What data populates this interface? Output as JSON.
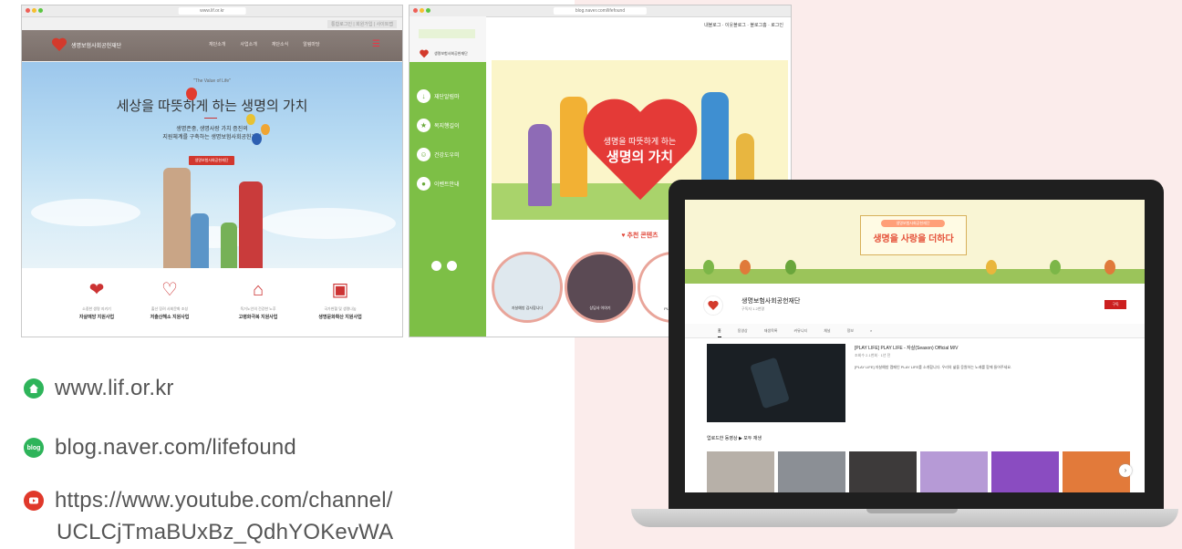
{
  "browser1": {
    "url": "www.lif.or.kr",
    "top_links": "통합로그인 | 회원가입 | 사이트맵",
    "logo_text": "생명보험사회공헌재단",
    "menu": [
      "재단소개",
      "사업소개",
      "재단소식",
      "알림마당"
    ],
    "hero_subtitle": "\"The Value of Life\"",
    "hero_title": "세상을 따뜻하게 하는 생명의 가치",
    "hero_desc1": "생명존중, 생명사랑 가치 증진의",
    "hero_desc2": "지원체계를 구축하는 생명보험사회공헌재단",
    "hero_button": "생명보험사회공헌재단",
    "services": [
      {
        "icon": "hands-heart-icon",
        "small": "소중한 생명 지키기",
        "label": "자살예방 지원사업"
      },
      {
        "icon": "pregnant-icon",
        "small": "출산 장려 사회문화 조성",
        "label": "저출산해소 지원사업"
      },
      {
        "icon": "house-heart-icon",
        "small": "독거노인의 건강한 노후",
        "label": "고령화극복 지원사업"
      },
      {
        "icon": "blood-bag-icon",
        "small": "국가헌혈 및 생명나눔",
        "label": "생명문화확산 지원사업"
      }
    ]
  },
  "browser2": {
    "url": "blog.naver.com/lifefound",
    "top_links": "내블로그 · 이웃블로그 · 블로그홈 · 로그인",
    "side_logo": "생명보험사회공헌재단",
    "side_menu": [
      "재단알림마",
      "복지행길이",
      "건강도우미",
      "이벤트안내"
    ],
    "hero_line1": "생명을 따뜻하게 하는",
    "hero_line2": "생명의 가치",
    "recommend_title": "♥ 추천 콘텐츠",
    "recommend": [
      "자살예방 감사합니다",
      "상담사 이야기",
      "PLAY LIFE"
    ]
  },
  "youtube": {
    "banner_tag": "생명보험사회공헌재단",
    "banner_title": "생명을 사랑을 더하다",
    "channel_name": "생명보험사회공헌재단",
    "subscribers": "구독자 1.2천명",
    "subscribe_label": "구독",
    "tabs": [
      "홈",
      "동영상",
      "재생목록",
      "커뮤니티",
      "채널",
      "정보"
    ],
    "featured_title": "[PLAY LIFE] PLAY LIFE - 자살(Season) Official M/V",
    "featured_meta": "조회수 2.1천회 · 1년 전",
    "featured_desc": "[PLAY LIFE] 자살예방 캠페인 PLAY LIFE를 소개합니다. 우리의 삶을 응원하는 노래를 함께 들어주세요.",
    "shelf_title": "업로드한 동영상 ▶ 모두 재생"
  },
  "links": {
    "website": "www.lif.or.kr",
    "blog": "blog.naver.com/lifefound",
    "blog_badge": "blog",
    "youtube_line1": "https://www.youtube.com/channel/",
    "youtube_line2": "UCLCjTmaBUxBz_QdhYOKevWA"
  },
  "colors": {
    "brand_red": "#d2382e",
    "blog_green": "#7dbf46",
    "youtube_red": "#e0392b",
    "home_green": "#2eb45a",
    "pink_bg": "#fbeceb"
  }
}
